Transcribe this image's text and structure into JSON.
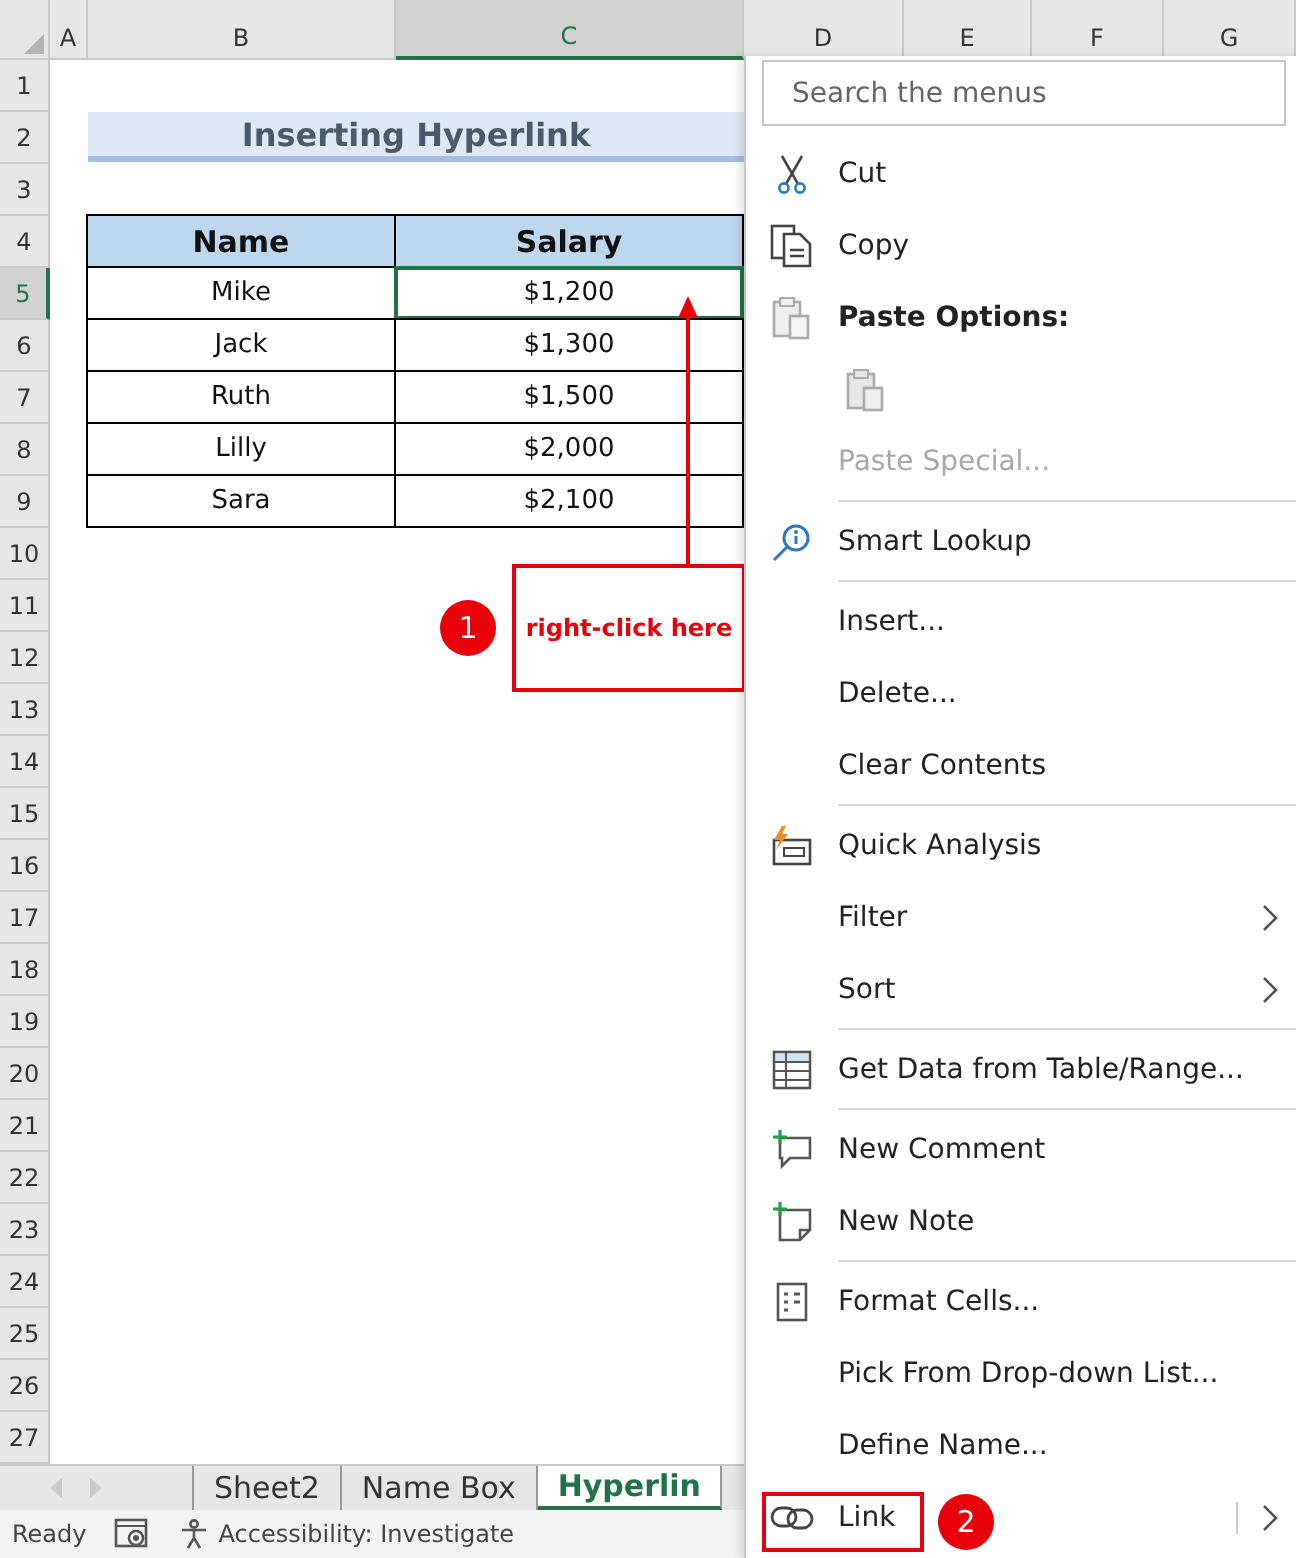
{
  "columns": [
    {
      "label": "A",
      "selected": false
    },
    {
      "label": "B",
      "selected": false
    },
    {
      "label": "C",
      "selected": true
    },
    {
      "label": "D",
      "selected": false
    },
    {
      "label": "E",
      "selected": false
    },
    {
      "label": "F",
      "selected": false
    },
    {
      "label": "G",
      "selected": false
    }
  ],
  "row_headers": [
    {
      "label": "1",
      "selected": false
    },
    {
      "label": "2",
      "selected": false
    },
    {
      "label": "3",
      "selected": false
    },
    {
      "label": "4",
      "selected": false
    },
    {
      "label": "5",
      "selected": true
    },
    {
      "label": "6",
      "selected": false
    },
    {
      "label": "7",
      "selected": false
    },
    {
      "label": "8",
      "selected": false
    },
    {
      "label": "9",
      "selected": false
    },
    {
      "label": "10",
      "selected": false
    },
    {
      "label": "11",
      "selected": false
    },
    {
      "label": "12",
      "selected": false
    },
    {
      "label": "13",
      "selected": false
    },
    {
      "label": "14",
      "selected": false
    },
    {
      "label": "15",
      "selected": false
    },
    {
      "label": "16",
      "selected": false
    },
    {
      "label": "17",
      "selected": false
    },
    {
      "label": "18",
      "selected": false
    },
    {
      "label": "19",
      "selected": false
    },
    {
      "label": "20",
      "selected": false
    },
    {
      "label": "21",
      "selected": false
    },
    {
      "label": "22",
      "selected": false
    },
    {
      "label": "23",
      "selected": false
    },
    {
      "label": "24",
      "selected": false
    },
    {
      "label": "25",
      "selected": false
    },
    {
      "label": "26",
      "selected": false
    },
    {
      "label": "27",
      "selected": false
    }
  ],
  "sheet_title": "Inserting Hyperlink",
  "table": {
    "headers": [
      "Name",
      "Salary"
    ],
    "rows": [
      {
        "name": "Mike",
        "salary": "$1,200",
        "selected": true
      },
      {
        "name": "Jack",
        "salary": "$1,300",
        "selected": false
      },
      {
        "name": "Ruth",
        "salary": "$1,500",
        "selected": false
      },
      {
        "name": "Lilly",
        "salary": "$2,000",
        "selected": false
      },
      {
        "name": "Sara",
        "salary": "$2,100",
        "selected": false
      }
    ]
  },
  "callouts": [
    {
      "number": "1",
      "text": "right-click here"
    },
    {
      "number": "2"
    }
  ],
  "context_menu": {
    "search": {
      "placeholder": "Search the menus"
    },
    "items": [
      {
        "kind": "item",
        "label": "Cut",
        "disabled": false,
        "submenu": false
      },
      {
        "kind": "item",
        "label": "Copy",
        "disabled": false,
        "submenu": false
      },
      {
        "kind": "heading",
        "label": "Paste Options:"
      },
      {
        "kind": "paste-icon"
      },
      {
        "kind": "item",
        "label": "Paste Special...",
        "disabled": true,
        "submenu": false
      },
      {
        "kind": "separator"
      },
      {
        "kind": "item",
        "label": "Smart Lookup",
        "disabled": false,
        "submenu": false
      },
      {
        "kind": "separator"
      },
      {
        "kind": "item",
        "label": "Insert...",
        "disabled": false,
        "submenu": false
      },
      {
        "kind": "item",
        "label": "Delete...",
        "disabled": false,
        "submenu": false
      },
      {
        "kind": "item",
        "label": "Clear Contents",
        "disabled": false,
        "submenu": false
      },
      {
        "kind": "separator"
      },
      {
        "kind": "item",
        "label": "Quick Analysis",
        "disabled": false,
        "submenu": false
      },
      {
        "kind": "item",
        "label": "Filter",
        "disabled": false,
        "submenu": true
      },
      {
        "kind": "item",
        "label": "Sort",
        "disabled": false,
        "submenu": true
      },
      {
        "kind": "separator"
      },
      {
        "kind": "item",
        "label": "Get Data from Table/Range...",
        "disabled": false,
        "submenu": false
      },
      {
        "kind": "separator"
      },
      {
        "kind": "item",
        "label": "New Comment",
        "disabled": false,
        "submenu": false
      },
      {
        "kind": "item",
        "label": "New Note",
        "disabled": false,
        "submenu": false
      },
      {
        "kind": "separator"
      },
      {
        "kind": "item",
        "label": "Format Cells...",
        "disabled": false,
        "submenu": false
      },
      {
        "kind": "item",
        "label": "Pick From Drop-down List...",
        "disabled": false,
        "submenu": false
      },
      {
        "kind": "item",
        "label": "Define Name...",
        "disabled": false,
        "submenu": false
      },
      {
        "kind": "item",
        "label": "Link",
        "disabled": false,
        "submenu": true
      }
    ]
  },
  "sheet_tabs": [
    {
      "label": "Sheet2",
      "selected": false
    },
    {
      "label": "Name Box",
      "selected": false
    },
    {
      "label": "Hyperlin",
      "selected": true
    }
  ],
  "status_bar": {
    "ready": "Ready",
    "accessibility": "Accessibility: Investigate"
  }
}
